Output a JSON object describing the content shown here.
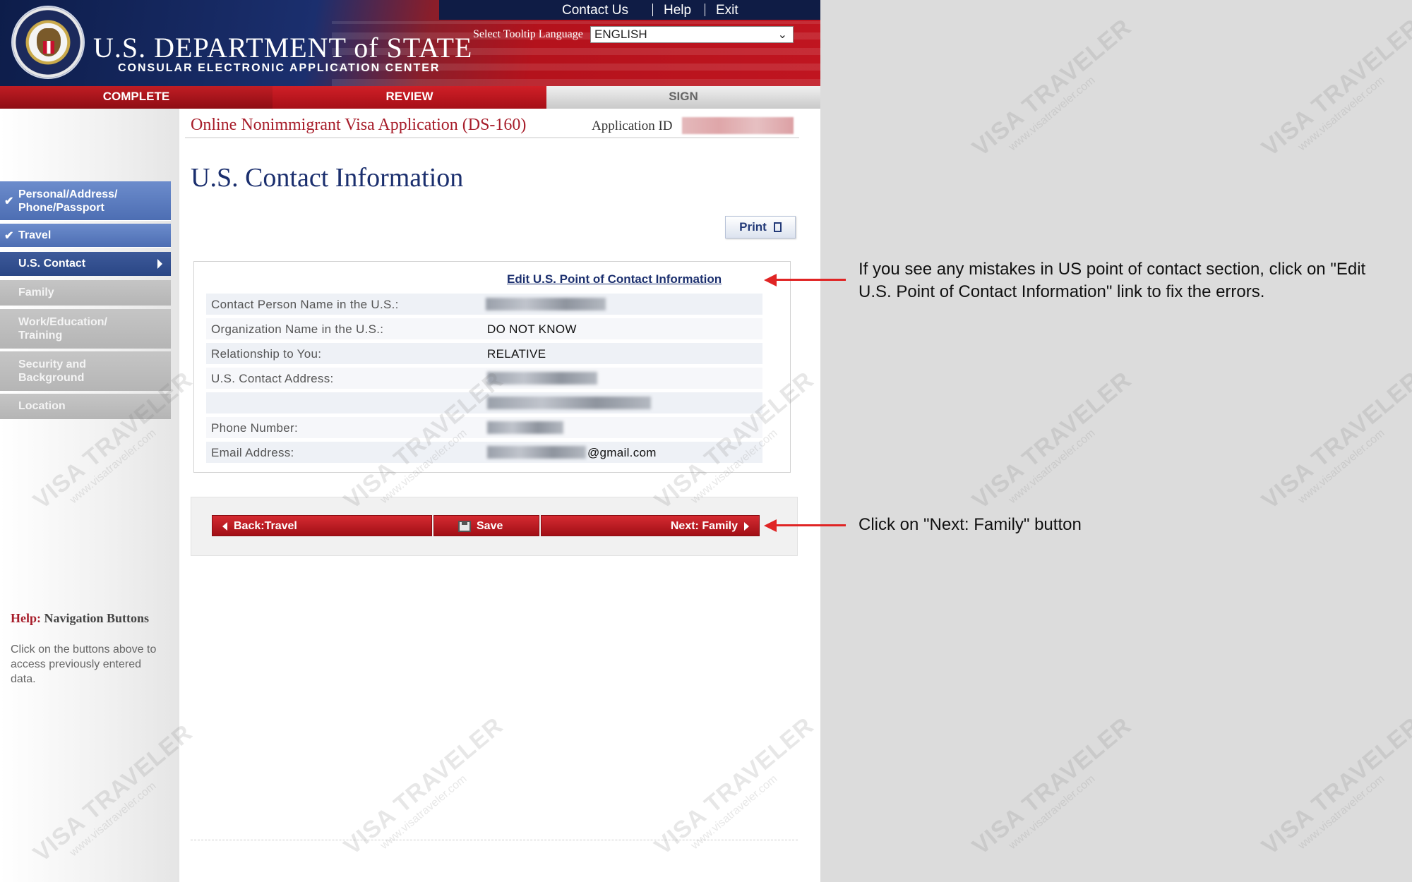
{
  "header": {
    "top_links": [
      "Contact Us",
      "Help",
      "Exit"
    ],
    "dept_title": "U.S. DEPARTMENT of STATE",
    "dept_subtitle": "CONSULAR ELECTRONIC APPLICATION CENTER",
    "tooltip_label": "Select Tooltip Language",
    "language": "ENGLISH"
  },
  "progress_tabs": [
    {
      "label": "COMPLETE",
      "state": "done"
    },
    {
      "label": "REVIEW",
      "state": "current"
    },
    {
      "label": "SIGN",
      "state": "pending"
    }
  ],
  "sidebar": {
    "items": [
      {
        "label": "Personal/Address/\nPhone/Passport",
        "state": "done"
      },
      {
        "label": "Travel",
        "state": "done"
      },
      {
        "label": "U.S. Contact",
        "state": "current"
      },
      {
        "label": "Family",
        "state": "todo"
      },
      {
        "label": "Work/Education/\nTraining",
        "state": "todo"
      },
      {
        "label": "Security and\nBackground",
        "state": "todo"
      },
      {
        "label": "Location",
        "state": "todo"
      }
    ],
    "help_prefix": "Help:",
    "help_title": "Navigation Buttons",
    "help_text": "Click on the buttons above to access previously entered data."
  },
  "main": {
    "form_title": "Online Nonimmigrant Visa Application (DS-160)",
    "app_id_label": "Application ID",
    "heading": "U.S. Contact Information",
    "print_label": "Print",
    "edit_link": "Edit U.S. Point of Contact Information",
    "rows": [
      {
        "label": "Contact Person Name in the U.S.:",
        "value": ""
      },
      {
        "label": "Organization Name in the U.S.:",
        "value": "DO NOT KNOW"
      },
      {
        "label": "Relationship to You:",
        "value": "RELATIVE"
      },
      {
        "label": "U.S. Contact Address:",
        "value": ""
      },
      {
        "label": "",
        "value": ""
      },
      {
        "label": "Phone Number:",
        "value": ""
      },
      {
        "label": "Email Address:",
        "value": "@gmail.com"
      }
    ],
    "buttons": {
      "back": "Back:Travel",
      "save": "Save",
      "next": "Next: Family"
    }
  },
  "annotations": {
    "edit_note": "If you see any mistakes in US point of contact section, click on \"Edit U.S. Point of Contact Information\" link to fix the errors.",
    "next_note": "Click on \"Next: Family\" button"
  },
  "watermark": {
    "brand": "VISA TRAVELER",
    "site": "www.visatraveler.com"
  },
  "colors": {
    "brand_red": "#a71d2a",
    "navy": "#1b2f6e",
    "arrow": "#e02424"
  }
}
